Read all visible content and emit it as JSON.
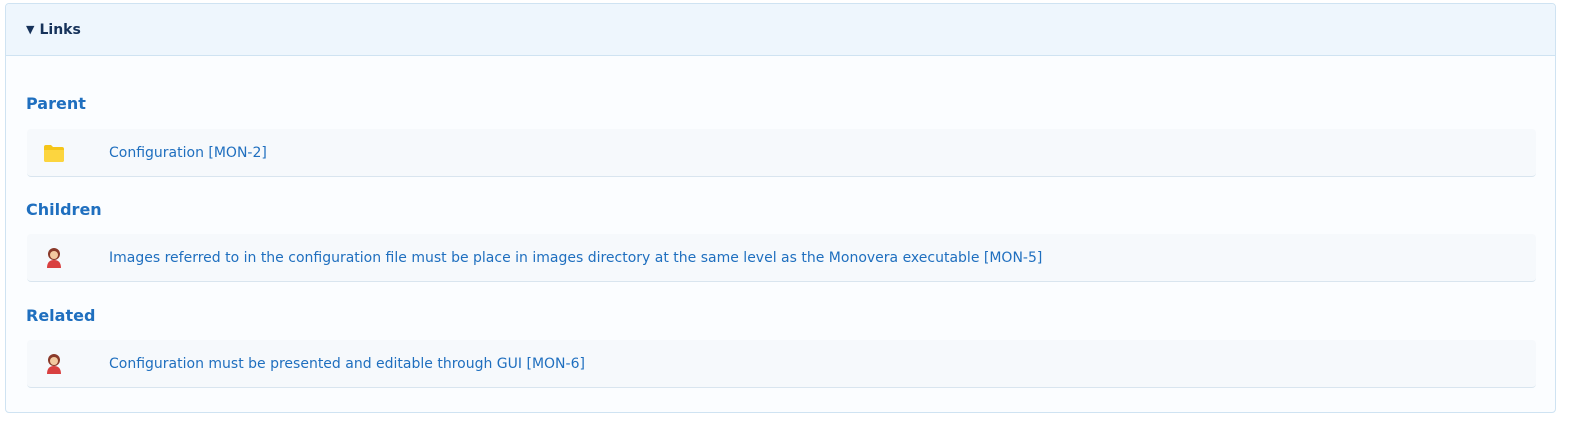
{
  "links_panel": {
    "title": "Links",
    "toggle_symbol": "▼"
  },
  "sections": {
    "parent": {
      "title": "Parent",
      "items": [
        {
          "label": "Configuration [MON-2]",
          "icon": "folder-icon"
        }
      ]
    },
    "children": {
      "title": "Children",
      "items": [
        {
          "label": "Images referred to in the configuration file must be place in images directory at the same level as the Monovera executable [MON-5]",
          "icon": "person-icon"
        }
      ]
    },
    "related": {
      "title": "Related",
      "items": [
        {
          "label": "Configuration must be presented and editable through GUI [MON-6]",
          "icon": "person-icon"
        }
      ]
    }
  },
  "colors": {
    "accent": "#1f6fbf",
    "header_bg": "#eef6fd",
    "folder": "#f5c518",
    "person": "#d94040"
  }
}
